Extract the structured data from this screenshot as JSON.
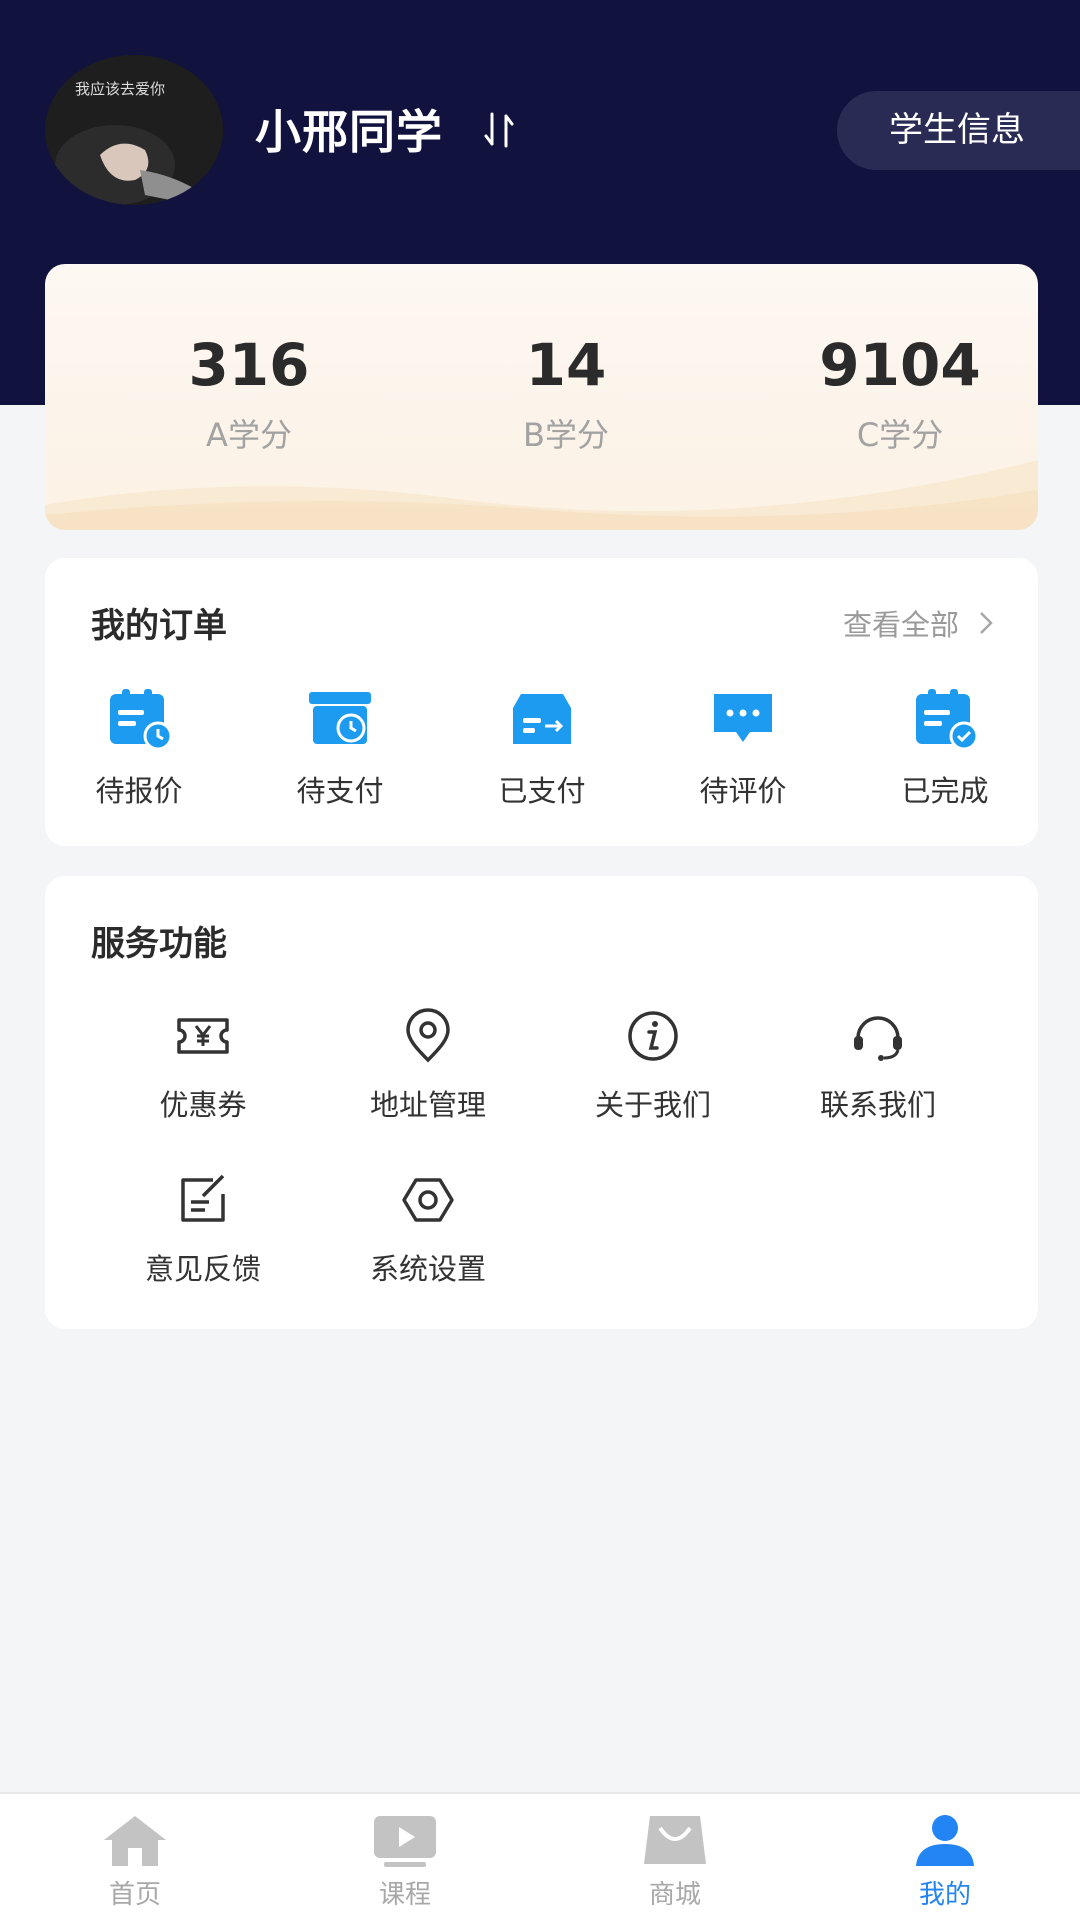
{
  "profile": {
    "name": "小邢同学",
    "student_info_button": "学生信息",
    "avatar_text": "我应该去爱你"
  },
  "credits": [
    {
      "value": "316",
      "label": "A学分"
    },
    {
      "value": "14",
      "label": "B学分"
    },
    {
      "value": "9104",
      "label": "C学分"
    }
  ],
  "orders": {
    "title": "我的订单",
    "view_all": "查看全部",
    "items": [
      {
        "label": "待报价",
        "icon": "clipboard-clock-icon"
      },
      {
        "label": "待支付",
        "icon": "wallet-clock-icon"
      },
      {
        "label": "已支付",
        "icon": "card-arrow-icon"
      },
      {
        "label": "待评价",
        "icon": "chat-bubble-icon"
      },
      {
        "label": "已完成",
        "icon": "clipboard-check-icon"
      }
    ]
  },
  "services": {
    "title": "服务功能",
    "items": [
      {
        "label": "优惠券",
        "icon": "coupon-icon"
      },
      {
        "label": "地址管理",
        "icon": "location-icon"
      },
      {
        "label": "关于我们",
        "icon": "info-icon"
      },
      {
        "label": "联系我们",
        "icon": "headset-icon"
      },
      {
        "label": "意见反馈",
        "icon": "feedback-edit-icon"
      },
      {
        "label": "系统设置",
        "icon": "settings-hex-icon"
      }
    ]
  },
  "tabbar": {
    "items": [
      {
        "label": "首页",
        "icon": "home-icon"
      },
      {
        "label": "课程",
        "icon": "play-icon"
      },
      {
        "label": "商城",
        "icon": "shop-bag-icon"
      },
      {
        "label": "我的",
        "icon": "user-icon",
        "active": true
      }
    ]
  },
  "colors": {
    "header": "#12123f",
    "accent_blue": "#2384f3",
    "icon_blue": "#1d9bf0"
  }
}
